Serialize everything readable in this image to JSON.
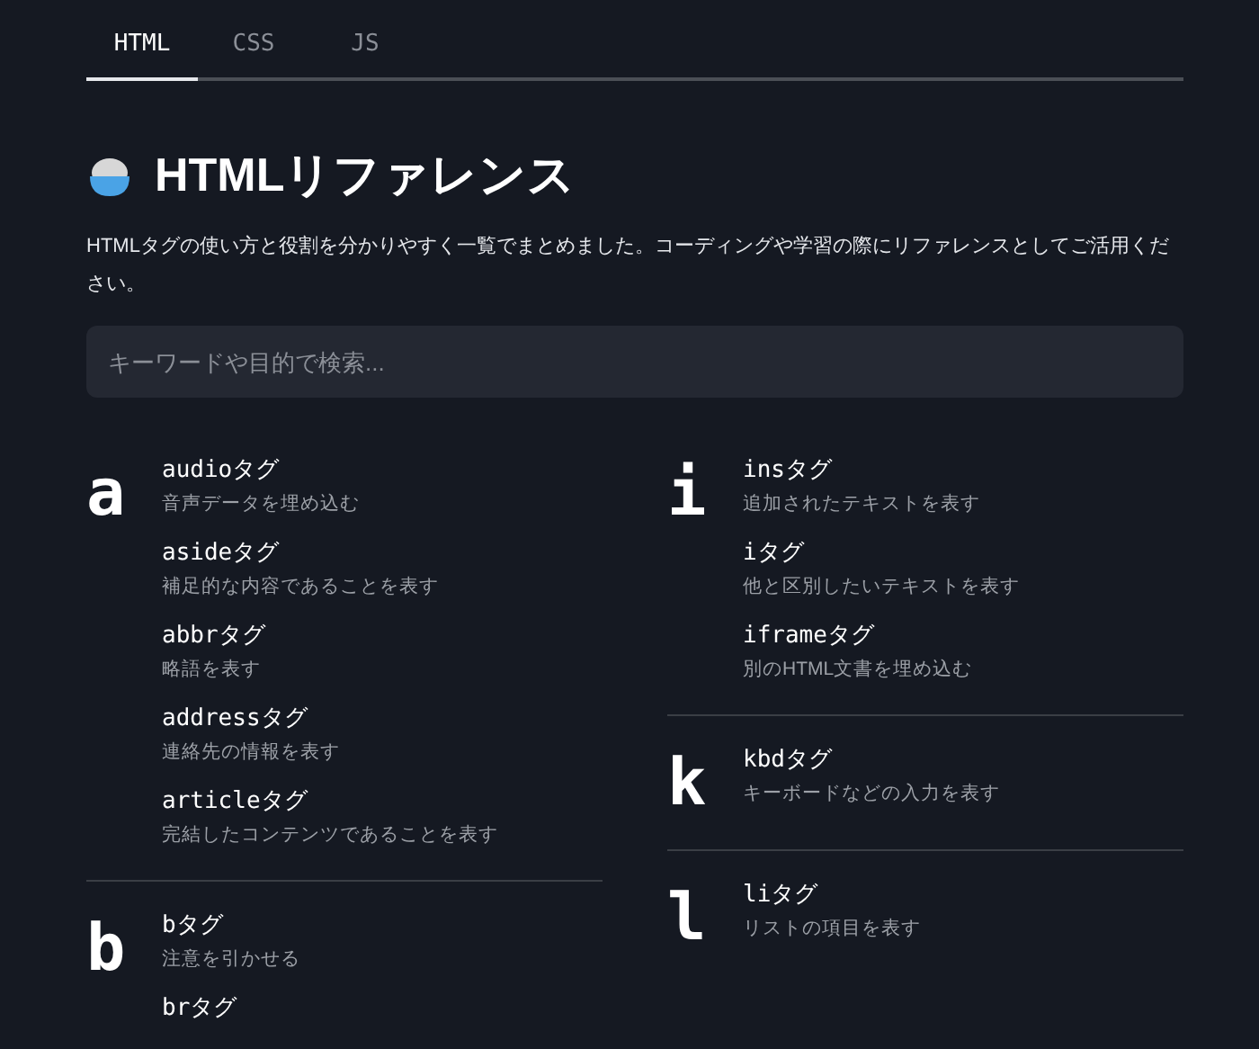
{
  "tabs": [
    {
      "label": "HTML",
      "selected": true
    },
    {
      "label": "CSS",
      "selected": false
    },
    {
      "label": "JS",
      "selected": false
    }
  ],
  "title": "HTMLリファレンス",
  "description": "HTMLタグの使い方と役割を分かりやすく一覧でまとめました。コーディングや学習の際にリファレンスとしてご活用ください。",
  "search": {
    "placeholder": "キーワードや目的で検索..."
  },
  "columns": [
    [
      {
        "letter": "a",
        "items": [
          {
            "name": "audioタグ",
            "description": "音声データを埋め込む"
          },
          {
            "name": "asideタグ",
            "description": "補足的な内容であることを表す"
          },
          {
            "name": "abbrタグ",
            "description": "略語を表す"
          },
          {
            "name": "addressタグ",
            "description": "連絡先の情報を表す"
          },
          {
            "name": "articleタグ",
            "description": "完結したコンテンツであることを表す"
          }
        ]
      },
      {
        "letter": "b",
        "items": [
          {
            "name": "bタグ",
            "description": "注意を引かせる"
          },
          {
            "name": "brタグ"
          }
        ]
      }
    ],
    [
      {
        "letter": "i",
        "items": [
          {
            "name": "insタグ",
            "description": "追加されたテキストを表す"
          },
          {
            "name": "iタグ",
            "description": "他と区別したいテキストを表す"
          },
          {
            "name": "iframeタグ",
            "description": "別のHTML文書を埋め込む"
          }
        ]
      },
      {
        "letter": "k",
        "items": [
          {
            "name": "kbdタグ",
            "description": "キーボードなどの入力を表す"
          }
        ]
      },
      {
        "letter": "l",
        "items": [
          {
            "name": "liタグ",
            "description": "リストの項目を表す"
          }
        ]
      }
    ]
  ]
}
